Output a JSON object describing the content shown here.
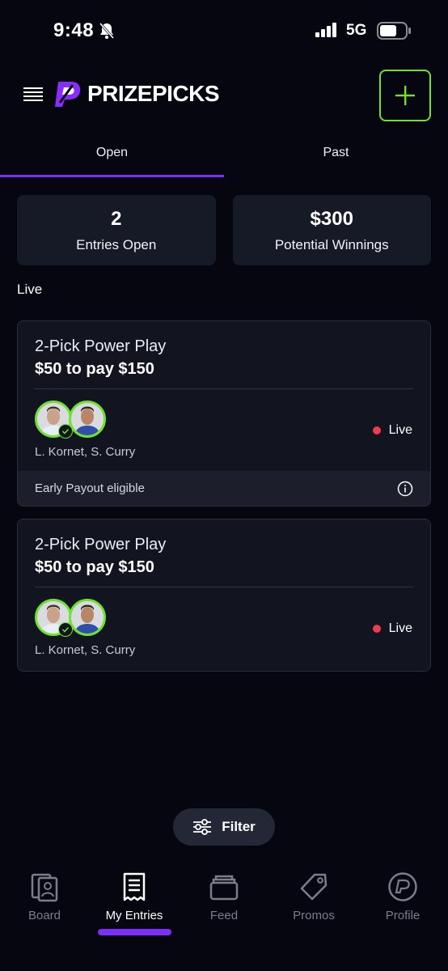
{
  "status_bar": {
    "time": "9:48",
    "network": "5G"
  },
  "header": {
    "brand": "PRIZEPICKS"
  },
  "tabs": [
    {
      "label": "Open"
    },
    {
      "label": "Past"
    }
  ],
  "summary": [
    {
      "value": "2",
      "label": "Entries Open"
    },
    {
      "value": "$300",
      "label": "Potential Winnings"
    }
  ],
  "section_label": "Live",
  "entries": [
    {
      "type": "2-Pick Power Play",
      "stake": "$50 to pay $150",
      "players": "L. Kornet, S. Curry",
      "status": "Live",
      "payout_note": "Early Payout eligible"
    },
    {
      "type": "2-Pick Power Play",
      "stake": "$50 to pay $150",
      "players": "L. Kornet, S. Curry",
      "status": "Live"
    }
  ],
  "filter": {
    "label": "Filter"
  },
  "nav": [
    {
      "label": "Board",
      "icon": "board-icon"
    },
    {
      "label": "My Entries",
      "icon": "entries-icon"
    },
    {
      "label": "Feed",
      "icon": "feed-icon"
    },
    {
      "label": "Promos",
      "icon": "promos-icon"
    },
    {
      "label": "Profile",
      "icon": "profile-icon"
    }
  ],
  "colors": {
    "accent_green": "#6fe12f",
    "accent_purple": "#7b2ff7",
    "live_red": "#ef3b4d",
    "background": "#05060f"
  }
}
